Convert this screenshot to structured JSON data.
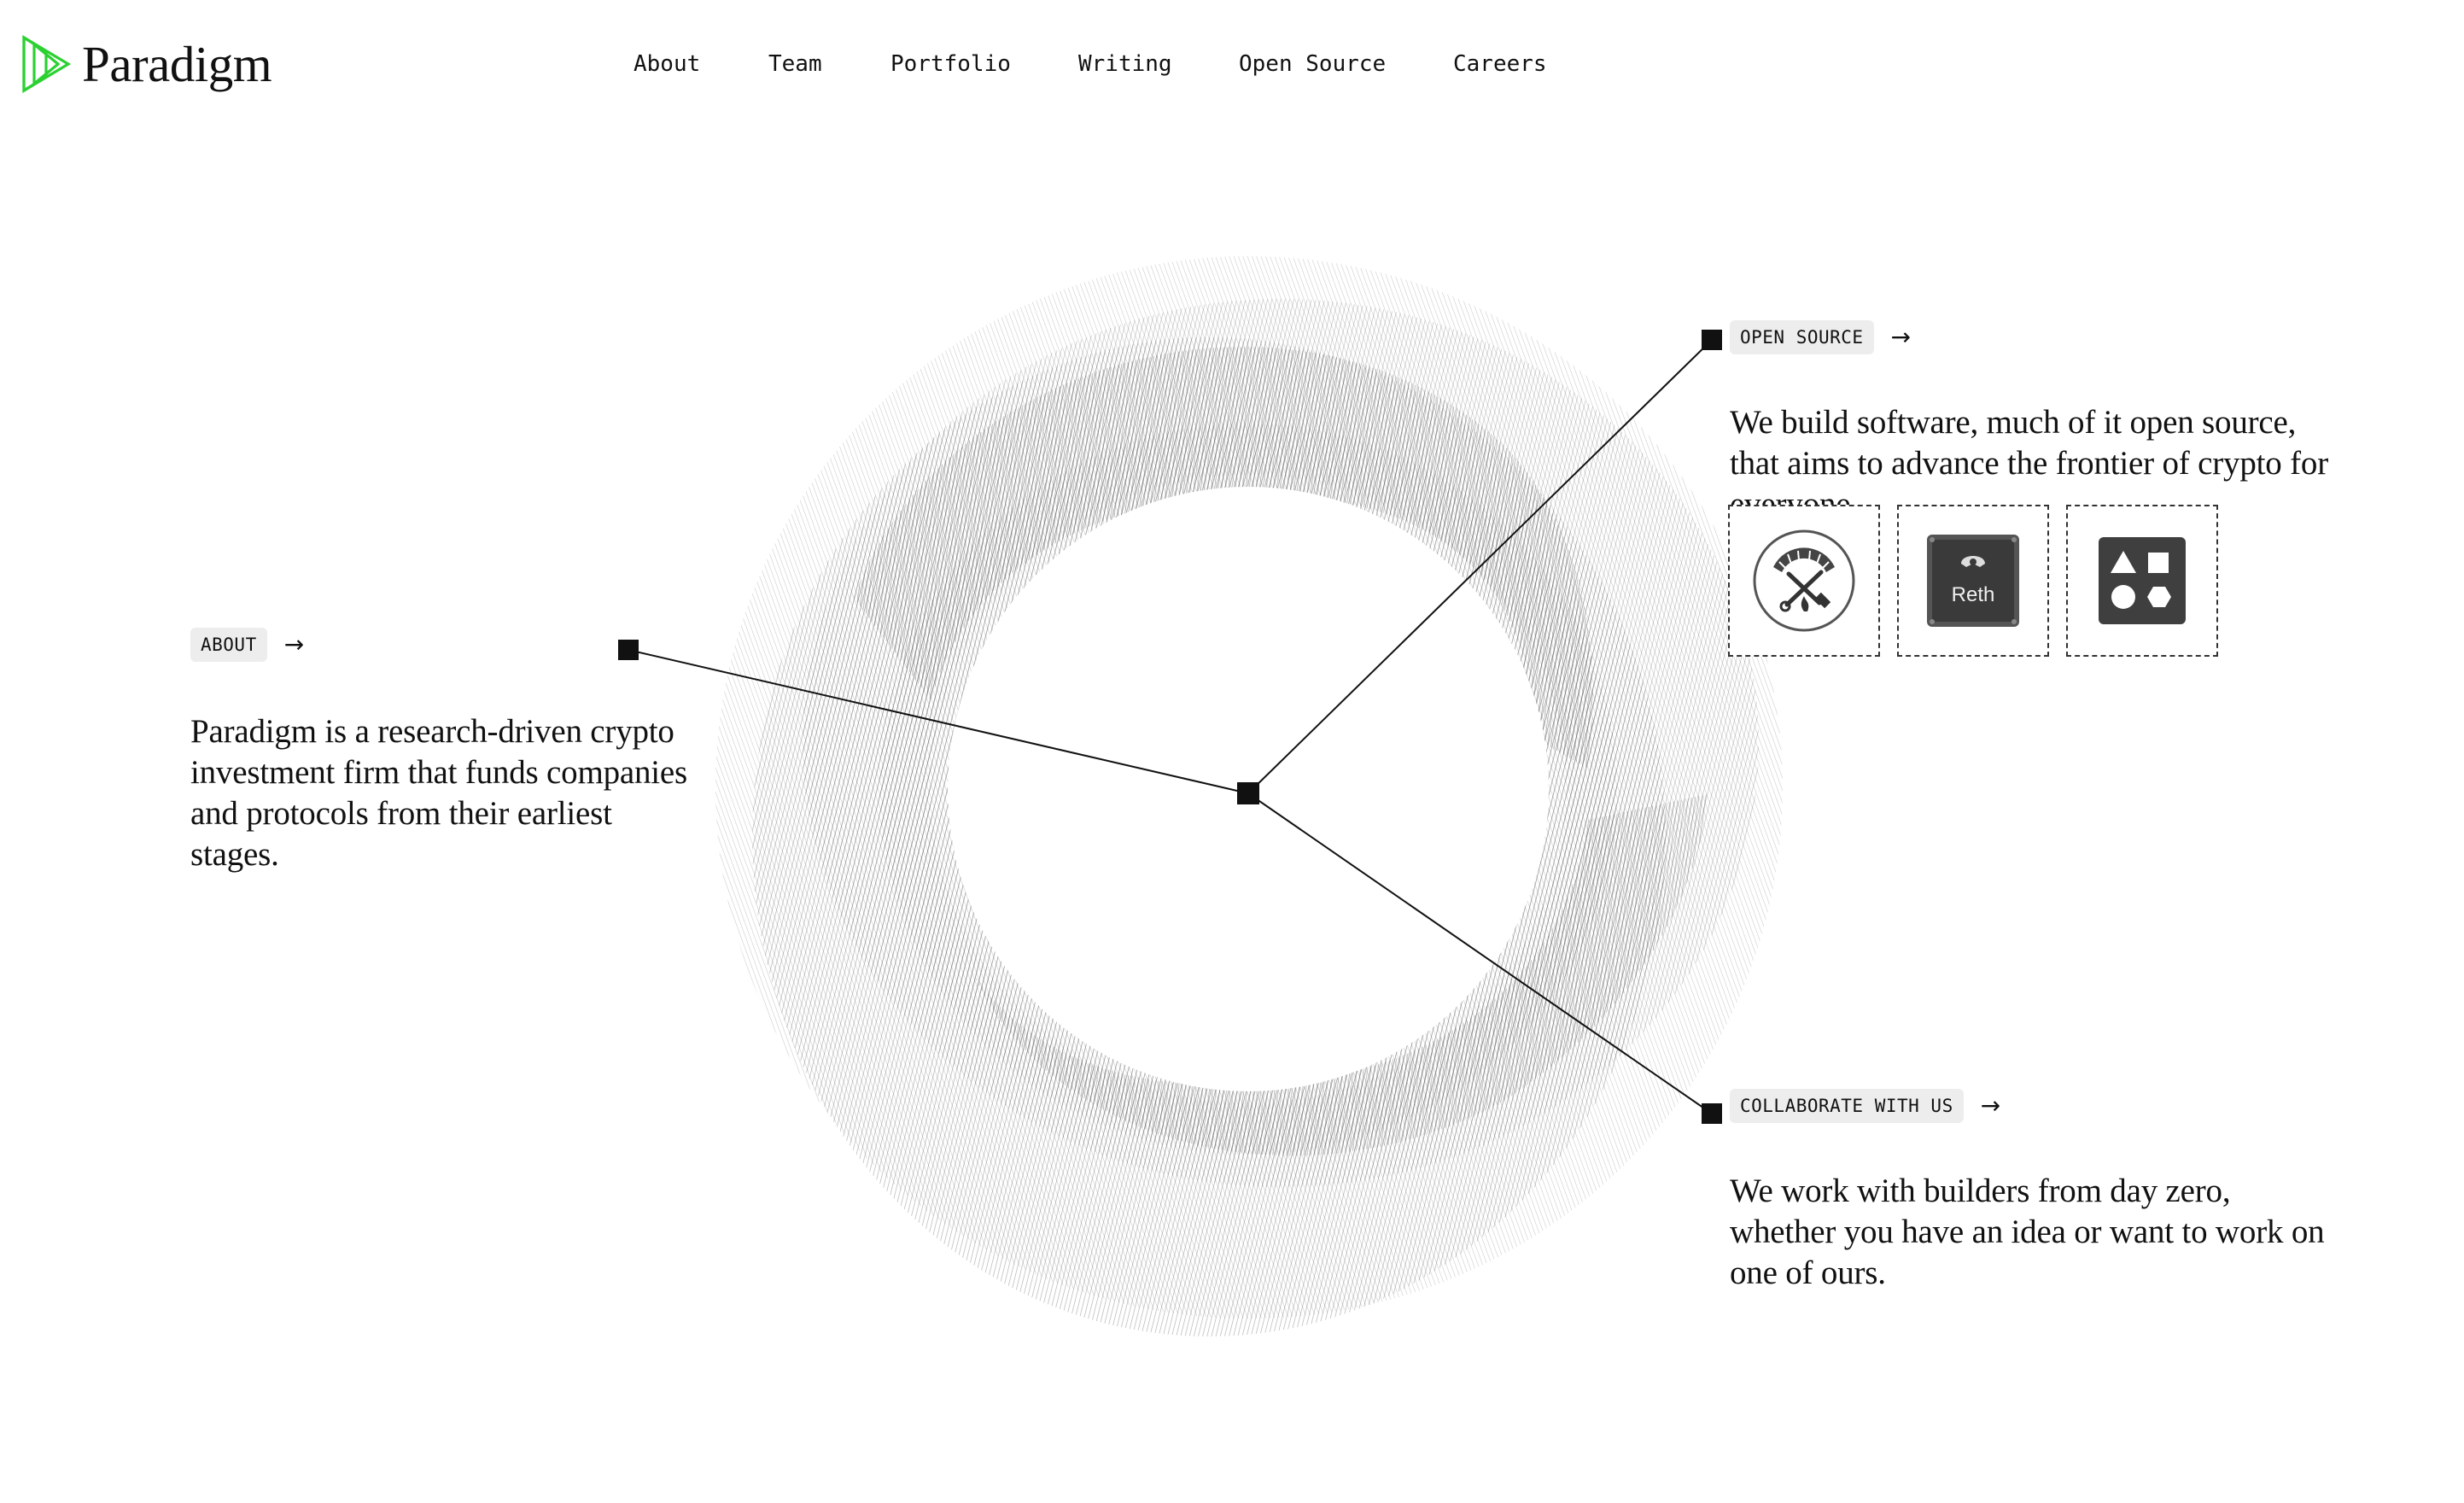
{
  "brand": {
    "name": "Paradigm",
    "accent_color": "#2bd131"
  },
  "nav": {
    "items": [
      {
        "label": "About"
      },
      {
        "label": "Team"
      },
      {
        "label": "Portfolio"
      },
      {
        "label": "Writing"
      },
      {
        "label": "Open Source"
      },
      {
        "label": "Careers"
      }
    ]
  },
  "callouts": {
    "about": {
      "tag": "ABOUT",
      "arrow": "→",
      "text": "Paradigm is a research-driven crypto investment firm that funds companies and protocols from their earliest stages."
    },
    "open_source": {
      "tag": "OPEN SOURCE",
      "arrow": "→",
      "text": "We build software, much of it open source, that aims to advance the frontier of crypto for everyone.",
      "projects": [
        {
          "icon": "foundry-icon"
        },
        {
          "icon": "reth-icon",
          "label": "Reth"
        },
        {
          "icon": "shapes-icon"
        }
      ]
    },
    "collaborate": {
      "tag": "COLLABORATE WITH US",
      "arrow": "→",
      "text": "We work with builders from day zero, whether you have an idea or want to work on one of ours."
    }
  },
  "colors": {
    "ink": "#111111",
    "tag_bg": "#ededed",
    "ring_stripe": "#8a8a8a"
  }
}
